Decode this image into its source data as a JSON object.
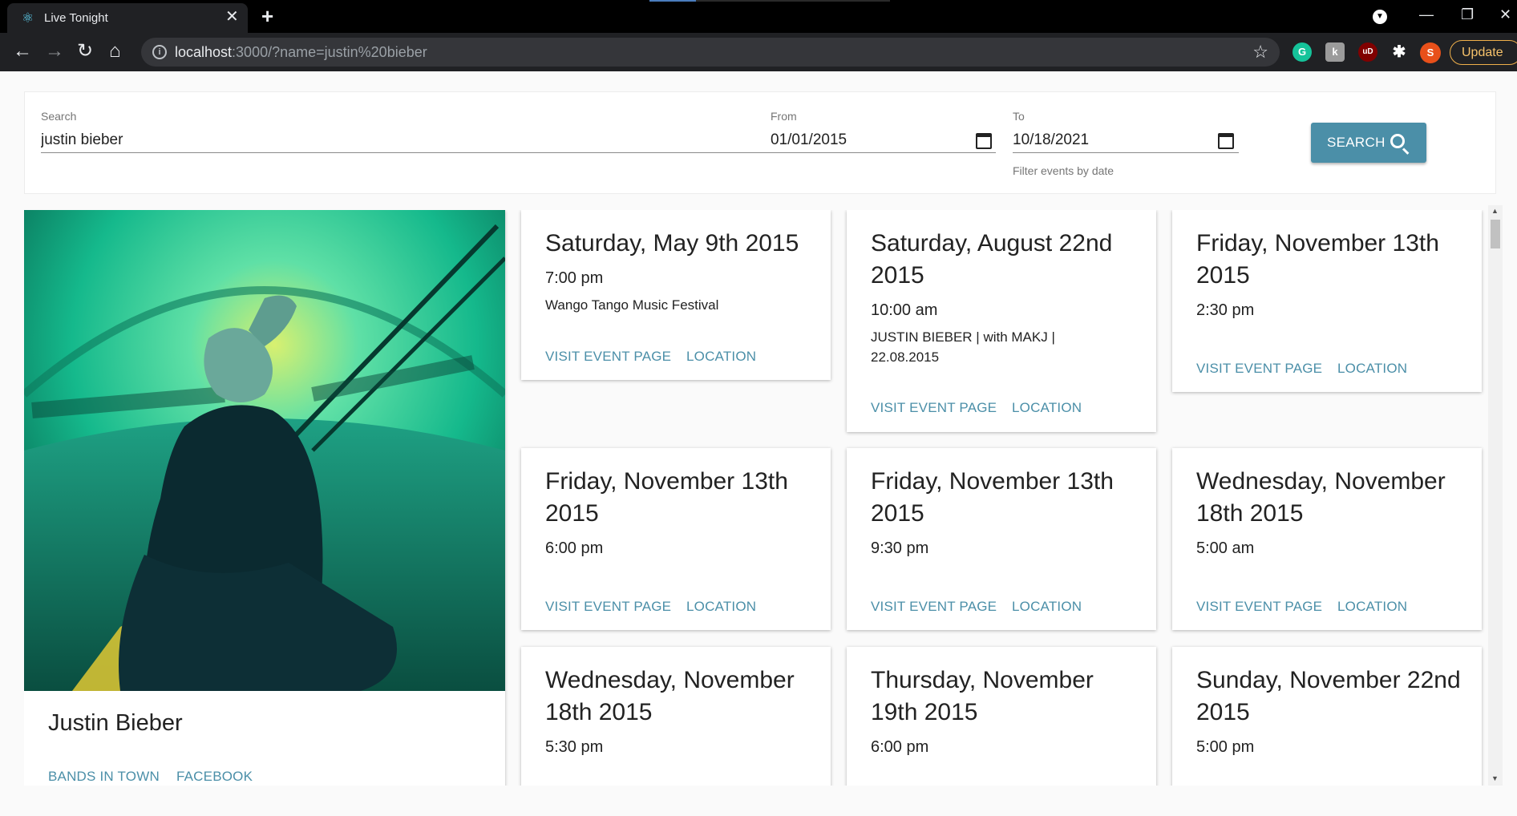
{
  "browser": {
    "tab_title": "Live Tonight",
    "url_host": "localhost",
    "url_rest": ":3000/?name=justin%20bieber",
    "profile_initial": "S",
    "update_label": "Update"
  },
  "search": {
    "label": "Search",
    "value": "justin bieber",
    "from_label": "From",
    "from_value": "01/01/2015",
    "to_label": "To",
    "to_value": "10/18/2021",
    "helper": "Filter events by date",
    "button_label": "SEARCH"
  },
  "artist": {
    "name": "Justin Bieber",
    "link_bands": "BANDS IN TOWN",
    "link_facebook": "FACEBOOK"
  },
  "event_actions": {
    "visit": "VISIT EVENT PAGE",
    "location": "LOCATION"
  },
  "events": [
    {
      "date": "Saturday, May 9th 2015",
      "time": "7:00 pm",
      "description": "Wango Tango Music Festival"
    },
    {
      "date": "Saturday, August 22nd 2015",
      "time": "10:00 am",
      "description": "JUSTIN BIEBER | with MAKJ | 22.08.2015"
    },
    {
      "date": "Friday, November 13th 2015",
      "time": "2:30 pm",
      "description": ""
    },
    {
      "date": "Friday, November 13th 2015",
      "time": "6:00 pm",
      "description": ""
    },
    {
      "date": "Friday, November 13th 2015",
      "time": "9:30 pm",
      "description": ""
    },
    {
      "date": "Wednesday, November 18th 2015",
      "time": "5:00 am",
      "description": ""
    },
    {
      "date": "Wednesday, November 18th 2015",
      "time": "5:30 pm",
      "description": ""
    },
    {
      "date": "Thursday, November 19th 2015",
      "time": "6:00 pm",
      "description": ""
    },
    {
      "date": "Sunday, November 22nd 2015",
      "time": "5:00 pm",
      "description": ""
    }
  ],
  "colors": {
    "accent": "#4b8fa8",
    "chrome_dark": "#202124"
  }
}
